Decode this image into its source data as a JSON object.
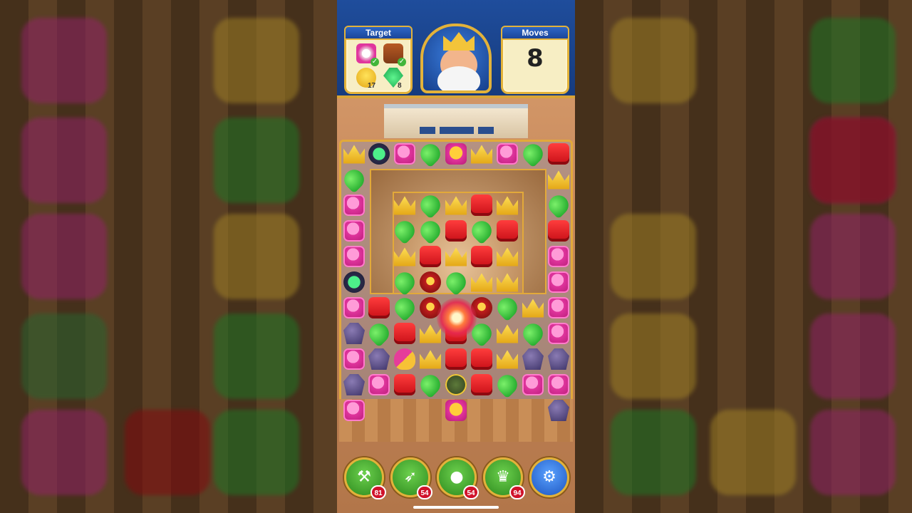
{
  "hud": {
    "target_label": "Target",
    "moves_label": "Moves",
    "moves_value": "8",
    "targets": [
      {
        "icon": "bowling-pin-icon",
        "status": "done"
      },
      {
        "icon": "chocolate-block-icon",
        "status": "done"
      },
      {
        "icon": "rubber-duck-icon",
        "count": "17"
      },
      {
        "icon": "green-gem-icon",
        "count": "8"
      }
    ],
    "character": "king-portrait"
  },
  "boosters": [
    {
      "name": "hammer-booster",
      "icon": "hammer-icon",
      "count": "81"
    },
    {
      "name": "arrow-booster",
      "icon": "arrow-icon",
      "count": "54"
    },
    {
      "name": "cannon-booster",
      "icon": "cannon-icon",
      "count": "54"
    },
    {
      "name": "jester-hat-booster",
      "icon": "jester-hat-icon",
      "count": "94"
    }
  ],
  "settings_icon": "gear-icon",
  "colors": {
    "hud_blue": "#1f4d9c",
    "gold_border": "#e2b23a",
    "booster_green": "#2d8a1e",
    "count_badge_red": "#d0122a"
  }
}
